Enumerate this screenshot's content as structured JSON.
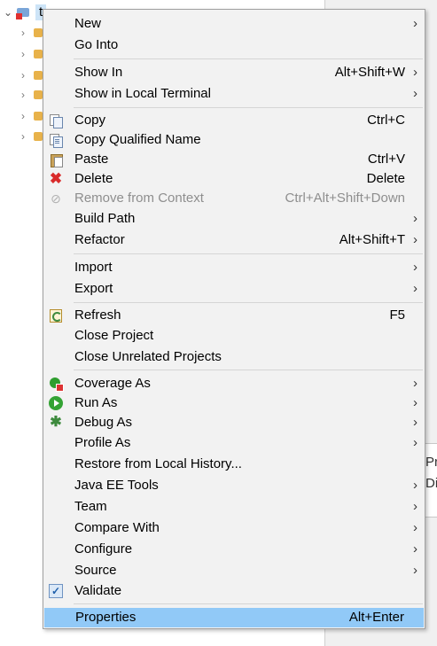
{
  "tree": {
    "root_label": "t",
    "child_count": 6
  },
  "right_panel": {
    "line1": "Pro",
    "line2": "Dis"
  },
  "menu": {
    "items": [
      {
        "label": "New",
        "shortcut": "",
        "submenu": true,
        "icon": ""
      },
      {
        "label": "Go Into",
        "shortcut": "",
        "submenu": false,
        "icon": ""
      },
      {
        "label": "Show In",
        "shortcut": "Alt+Shift+W",
        "submenu": true,
        "icon": ""
      },
      {
        "label": "Show in Local Terminal",
        "shortcut": "",
        "submenu": true,
        "icon": ""
      },
      {
        "label": "Copy",
        "shortcut": "Ctrl+C",
        "submenu": false,
        "icon": "copy-icon"
      },
      {
        "label": "Copy Qualified Name",
        "shortcut": "",
        "submenu": false,
        "icon": "copy-qualified-icon"
      },
      {
        "label": "Paste",
        "shortcut": "Ctrl+V",
        "submenu": false,
        "icon": "paste-icon"
      },
      {
        "label": "Delete",
        "shortcut": "Delete",
        "submenu": false,
        "icon": "delete-icon"
      },
      {
        "label": "Remove from Context",
        "shortcut": "Ctrl+Alt+Shift+Down",
        "submenu": false,
        "icon": "remove-context-icon",
        "disabled": true
      },
      {
        "label": "Build Path",
        "shortcut": "",
        "submenu": true,
        "icon": ""
      },
      {
        "label": "Refactor",
        "shortcut": "Alt+Shift+T",
        "submenu": true,
        "icon": ""
      },
      {
        "label": "Import",
        "shortcut": "",
        "submenu": true,
        "icon": ""
      },
      {
        "label": "Export",
        "shortcut": "",
        "submenu": true,
        "icon": ""
      },
      {
        "label": "Refresh",
        "shortcut": "F5",
        "submenu": false,
        "icon": "refresh-icon"
      },
      {
        "label": "Close Project",
        "shortcut": "",
        "submenu": false,
        "icon": ""
      },
      {
        "label": "Close Unrelated Projects",
        "shortcut": "",
        "submenu": false,
        "icon": ""
      },
      {
        "label": "Coverage As",
        "shortcut": "",
        "submenu": true,
        "icon": "coverage-icon"
      },
      {
        "label": "Run As",
        "shortcut": "",
        "submenu": true,
        "icon": "run-icon"
      },
      {
        "label": "Debug As",
        "shortcut": "",
        "submenu": true,
        "icon": "debug-icon"
      },
      {
        "label": "Profile As",
        "shortcut": "",
        "submenu": true,
        "icon": ""
      },
      {
        "label": "Restore from Local History...",
        "shortcut": "",
        "submenu": false,
        "icon": ""
      },
      {
        "label": "Java EE Tools",
        "shortcut": "",
        "submenu": true,
        "icon": ""
      },
      {
        "label": "Team",
        "shortcut": "",
        "submenu": true,
        "icon": ""
      },
      {
        "label": "Compare With",
        "shortcut": "",
        "submenu": true,
        "icon": ""
      },
      {
        "label": "Configure",
        "shortcut": "",
        "submenu": true,
        "icon": ""
      },
      {
        "label": "Source",
        "shortcut": "",
        "submenu": true,
        "icon": ""
      },
      {
        "label": "Validate",
        "shortcut": "",
        "submenu": false,
        "icon": "validate-check-icon"
      },
      {
        "label": "Properties",
        "shortcut": "Alt+Enter",
        "submenu": false,
        "icon": "",
        "selected": true
      }
    ],
    "colors": {
      "background": "#f2f2f2",
      "selected": "#91c9f7",
      "disabled_text": "#8e8e8e"
    }
  }
}
